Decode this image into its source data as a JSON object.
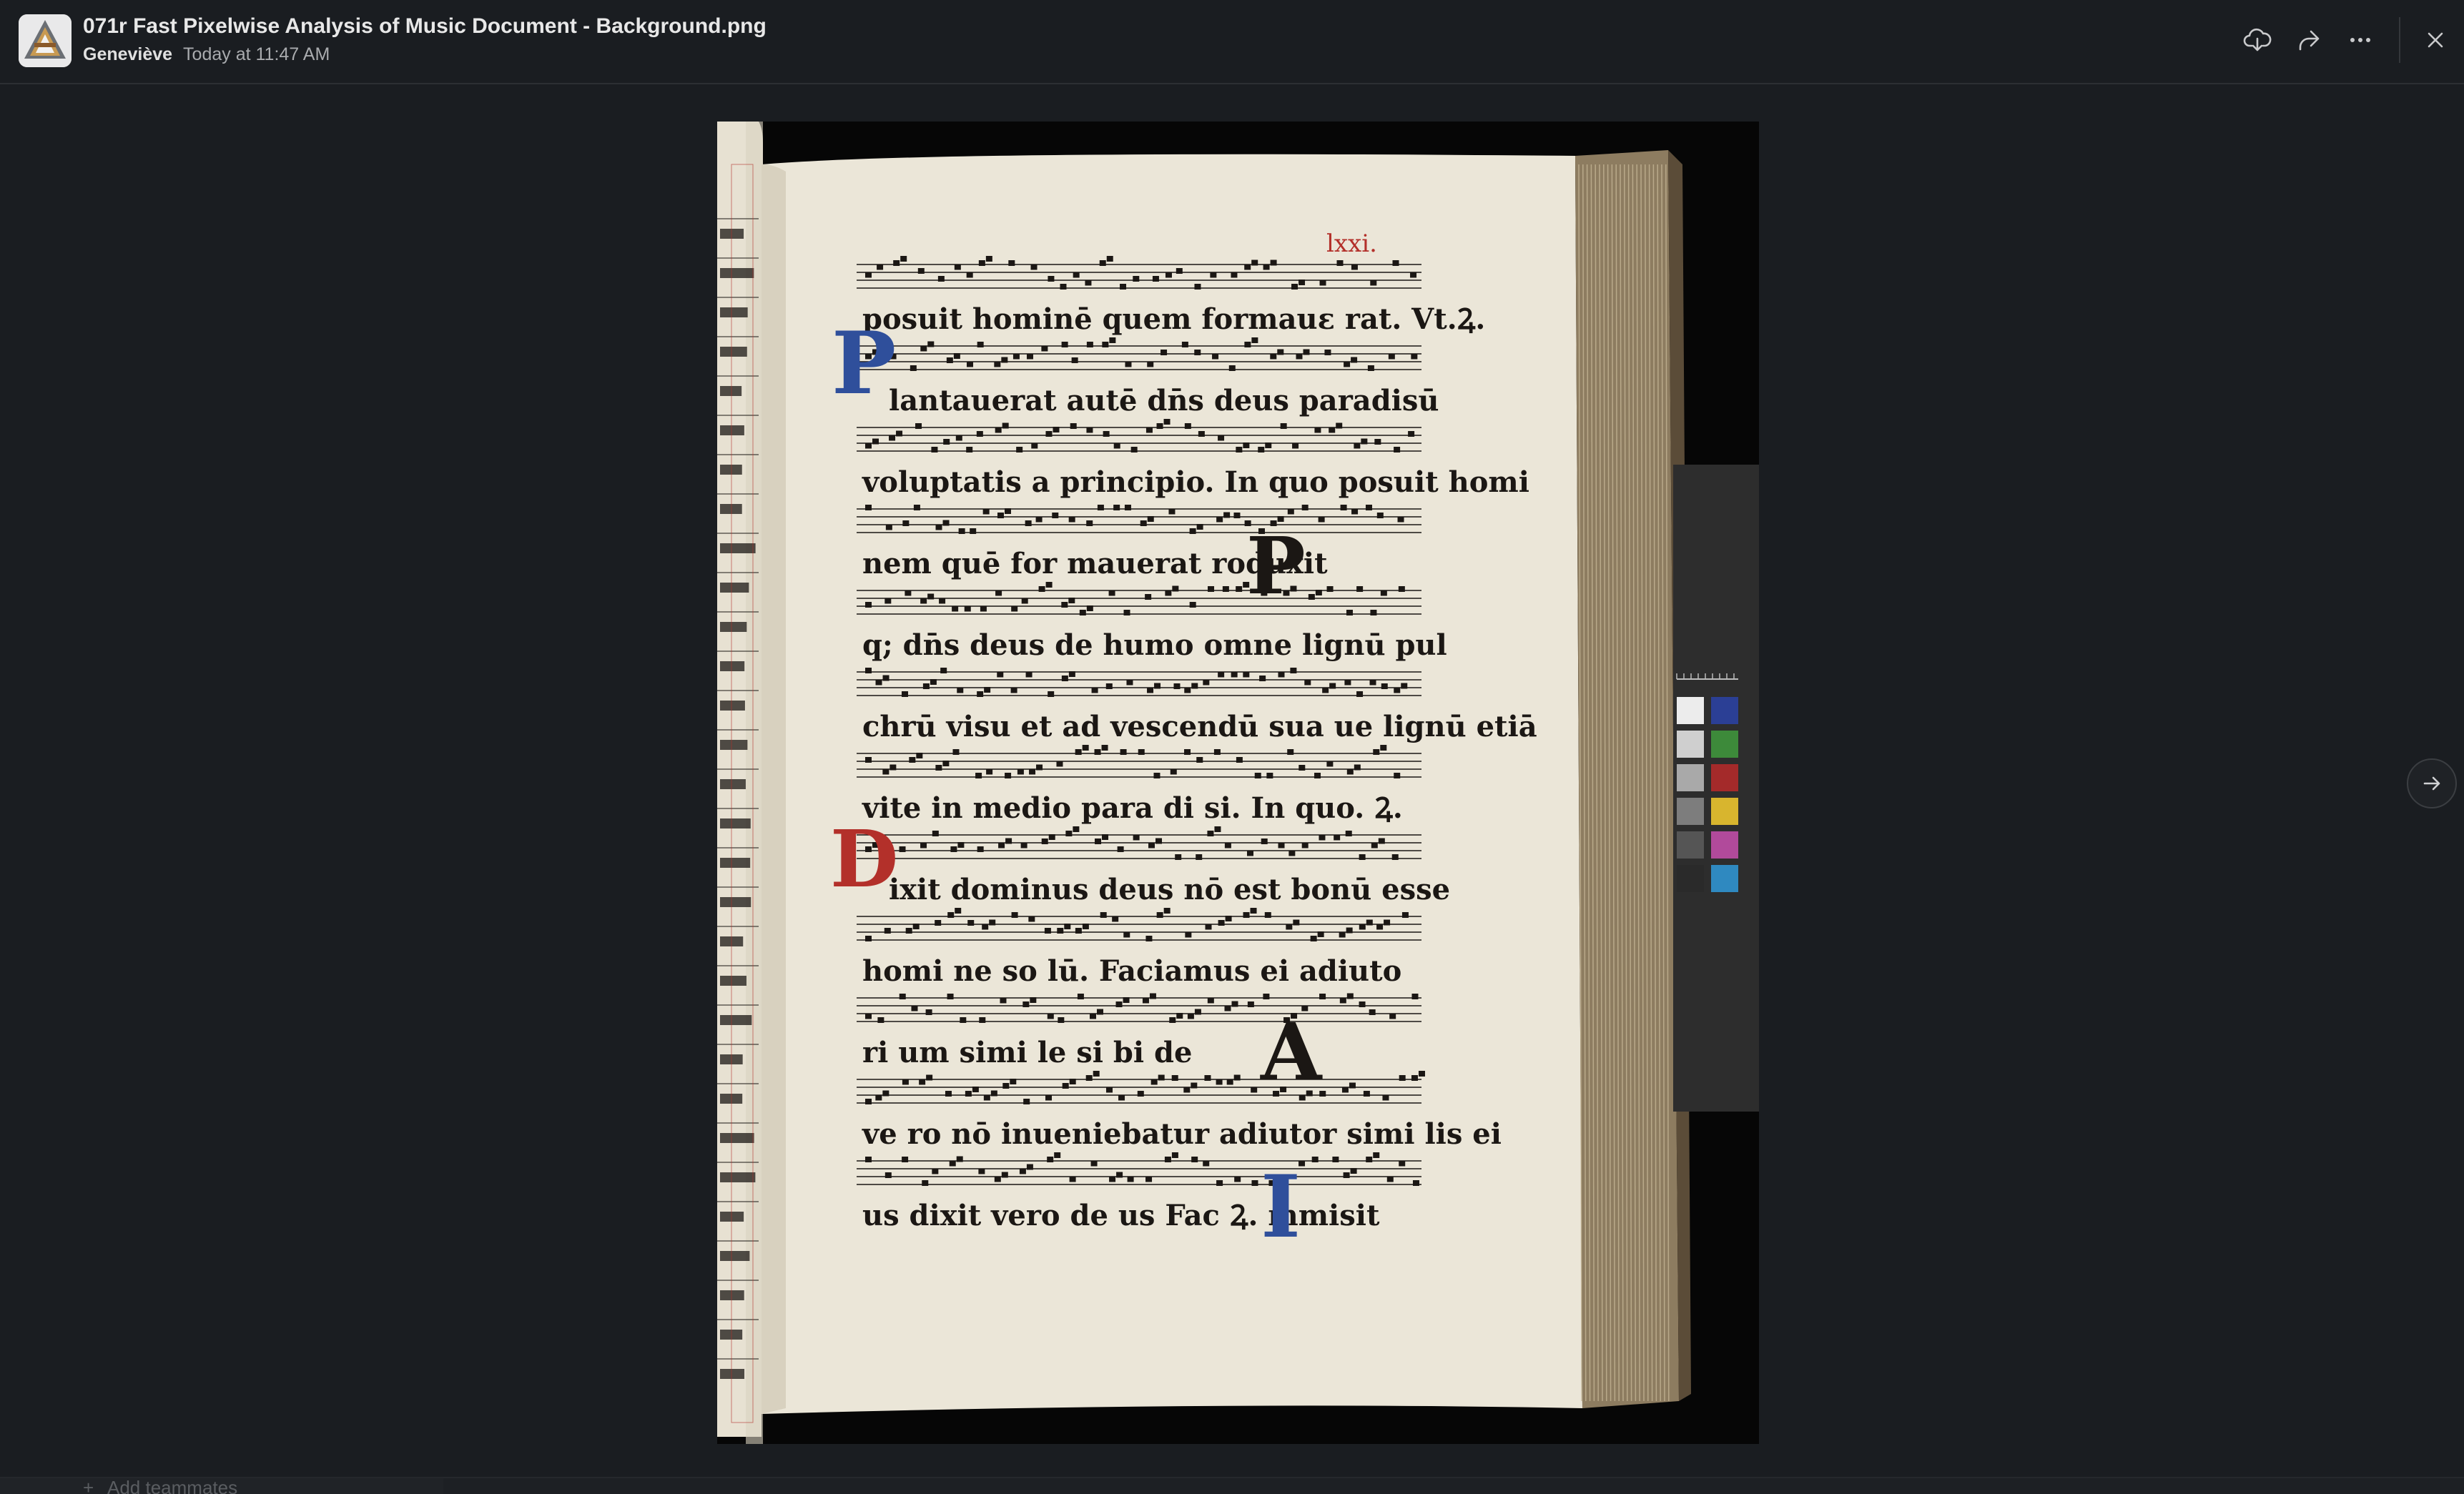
{
  "header": {
    "title": "071r Fast Pixelwise Analysis of Music Document - Background.png",
    "author": "Geneviève",
    "timestamp": "Today at 11:47 AM",
    "actions": [
      {
        "name": "download-icon"
      },
      {
        "name": "share-icon"
      },
      {
        "name": "more-icon"
      },
      {
        "name": "close-icon"
      }
    ]
  },
  "image": {
    "folio_number": "lxxi.",
    "lines": [
      "posuit hominē quem formauε    rat. Vt.Ꝝ.",
      "lantauerat autē dn̄s deus     paradisū",
      "voluptatis a principio. In quo posuit homi",
      "nem   quē for   mauerat         roduxit",
      "q;   dn̄s deus de humo omne lignū pul",
      "chrū visu et ad vescendū sua   ue lignū etiā",
      "vite in medio   para    di   si. In quo. Ꝝ.",
      "ixit dominus deus        nō est bonū esse",
      "homi    ne so    lū. Faciamus ei adiuto",
      "ri   um simi le      si     bi          de",
      "ve  ro nō inueniebatur adiutor simi lis ei",
      "  us dixit vero de  us  Fac  Ꝝ.      mmisit"
    ]
  },
  "footer": {
    "add_teammates": "Add teammates"
  },
  "colors": {
    "background": "#1a1d21",
    "parchment": "#ece7da",
    "ink": "#1b1714",
    "rubric_red": "#b3302a",
    "initial_blue": "#2f4f9b"
  }
}
